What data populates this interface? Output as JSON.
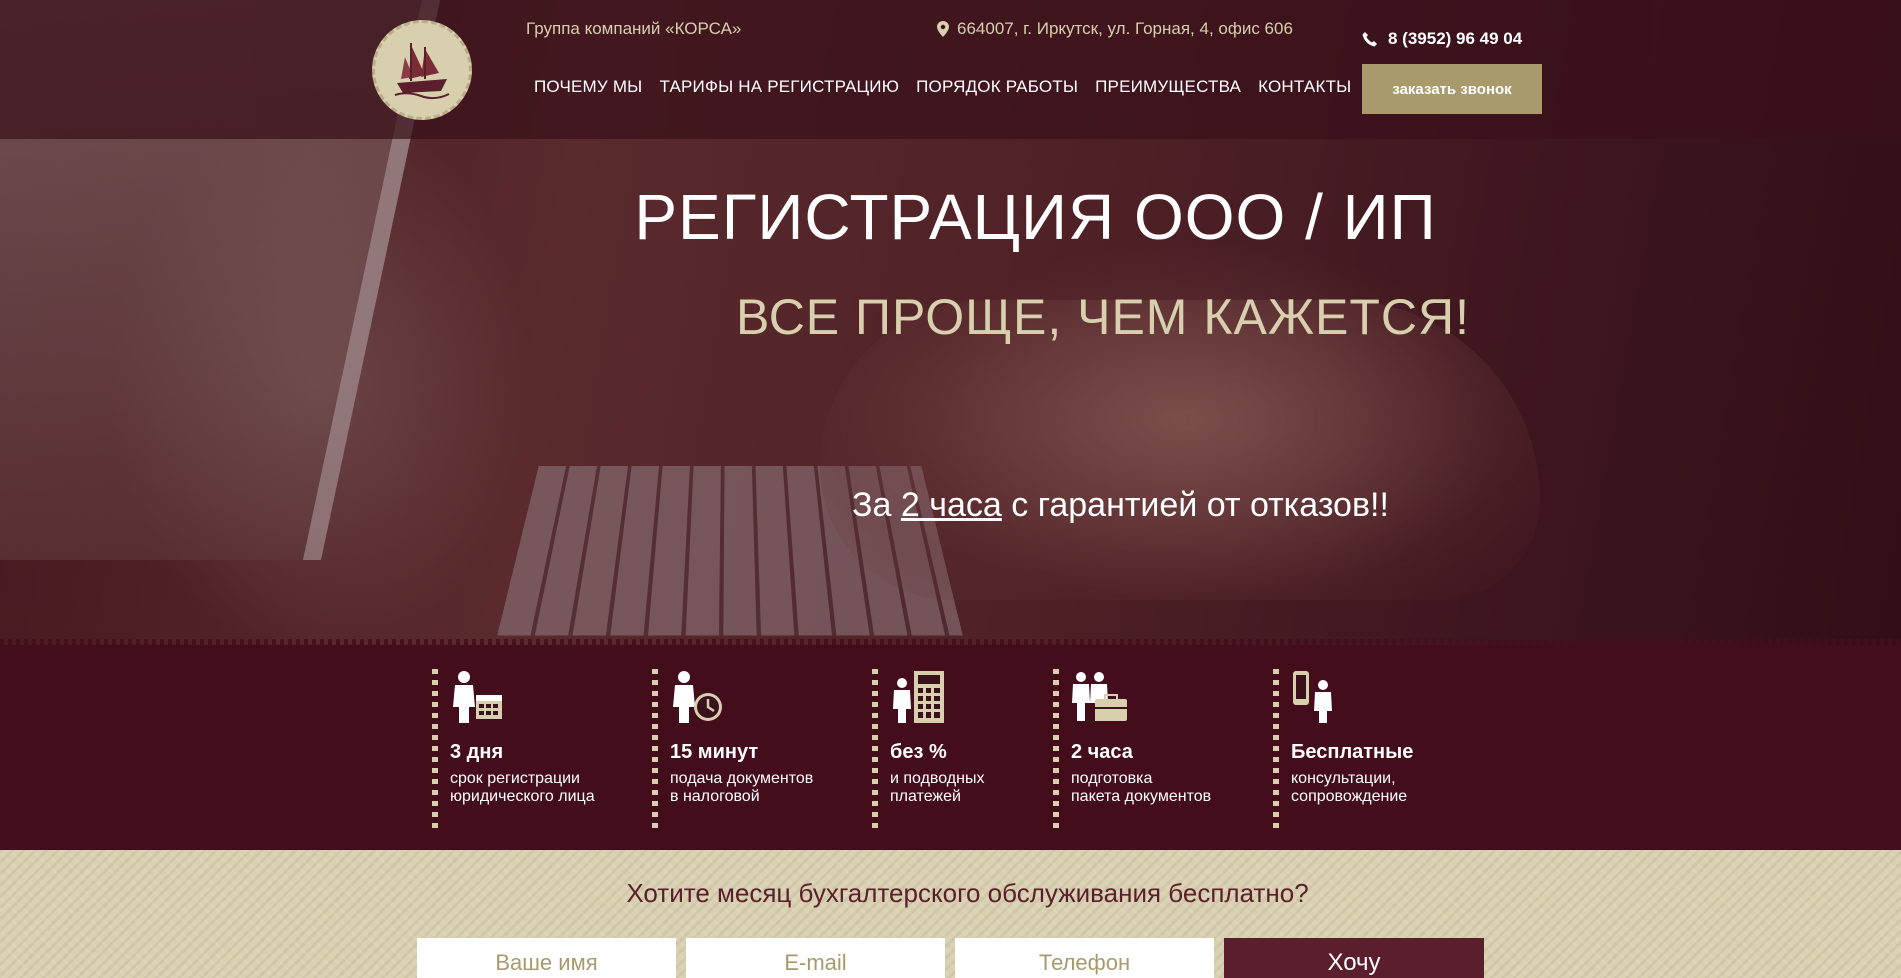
{
  "header": {
    "group_name": "Группа компаний «КОРСА»",
    "address": "664007, г. Иркутск, ул. Горная, 4, офис 606",
    "phone": "8 (3952) 96 49 04",
    "callback_label": "заказать звонок",
    "nav": [
      {
        "label": "ПОЧЕМУ МЫ"
      },
      {
        "label": "ТАРИФЫ НА РЕГИСТРАЦИЮ"
      },
      {
        "label": "ПОРЯДОК РАБОТЫ"
      },
      {
        "label": "ПРЕИМУЩЕСТВА"
      },
      {
        "label": "КОНТАКТЫ"
      }
    ]
  },
  "hero": {
    "title": "РЕГИСТРАЦИЯ ООО / ИП",
    "subtitle": "ВСЕ ПРОЩЕ, ЧЕМ КАЖЕТСЯ!",
    "tagline_prefix": "За ",
    "tagline_emphasis": "2 часа",
    "tagline_suffix": " с гарантией от отказов!!"
  },
  "features": [
    {
      "title": "3 дня",
      "line1": "срок регистрации",
      "line2": "юридического лица",
      "icon": "calendar-icon"
    },
    {
      "title": "15 минут",
      "line1": "подача документов",
      "line2": "в налоговой",
      "icon": "clock-icon"
    },
    {
      "title": "без %",
      "line1": "и подводных",
      "line2": "платежей",
      "icon": "calculator-icon"
    },
    {
      "title": "2 часа",
      "line1": "подготовка",
      "line2": "пакета документов",
      "icon": "briefcase-icon"
    },
    {
      "title": "Бесплатные",
      "line1": "консультации,",
      "line2": "сопровождение",
      "icon": "phone-icon"
    }
  ],
  "offer": {
    "title": "Хотите месяц бухгалтерского обслуживания бесплатно?",
    "name_placeholder": "Ваше имя",
    "email_placeholder": "E-mail",
    "phone_placeholder": "Телефон",
    "submit_label": "Хочу"
  },
  "colors": {
    "accent": "#a99a6d",
    "beige": "#d8cfae",
    "burgundy": "#5a1e2c"
  }
}
